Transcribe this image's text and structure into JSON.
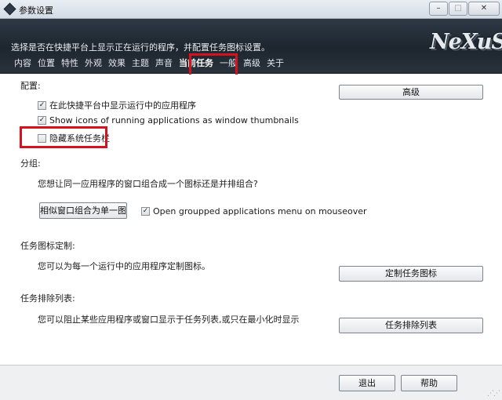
{
  "window": {
    "title": "参数设置",
    "controls": {
      "minimize": "–",
      "maximize": "□",
      "close": "✕"
    }
  },
  "header": {
    "description": "选择是否在快捷平台上显示正在运行的程序，并配置任务图标设置。",
    "logo": "NeXuS",
    "tabs": [
      {
        "label": "内容"
      },
      {
        "label": "位置"
      },
      {
        "label": "特性"
      },
      {
        "label": "外观"
      },
      {
        "label": "效果"
      },
      {
        "label": "主题"
      },
      {
        "label": "声音"
      },
      {
        "label": "当前任务",
        "active": true
      },
      {
        "label": "一般"
      },
      {
        "label": "高级"
      },
      {
        "label": "关于"
      }
    ]
  },
  "config": {
    "heading": "配置:",
    "advanced_button": "高级",
    "options": [
      {
        "label": "在此快捷平台中显示运行中的应用程序",
        "checked": true,
        "mark": "✓"
      },
      {
        "label": "Show icons of running applications as window thumbnails",
        "checked": true,
        "mark": "✓"
      },
      {
        "label": "隐藏系统任务栏",
        "checked": false,
        "mark": ""
      }
    ]
  },
  "grouping": {
    "heading": "分组:",
    "question": "您想让同一应用程序的窗口组合成一个图标还是并排组合?",
    "group_button": "相似窗口组合为单一图",
    "menu_option": {
      "label": "Open groupped applications menu on mouseover",
      "checked": true,
      "mark": "✓"
    }
  },
  "task_icons": {
    "heading": "任务图标定制:",
    "description": "您可以为每一个运行中的应用程序定制图标。",
    "button": "定制任务图标"
  },
  "exclusion": {
    "heading": "任务排除列表:",
    "description": "您可以阻止某些应用程序或窗口显示于任务列表,或只在最小化时显示",
    "button": "任务排除列表"
  },
  "footer": {
    "exit_button": "退出",
    "help_button": "帮助"
  },
  "colors": {
    "header_bg": "#1d252e",
    "highlight": "#d8121c"
  }
}
